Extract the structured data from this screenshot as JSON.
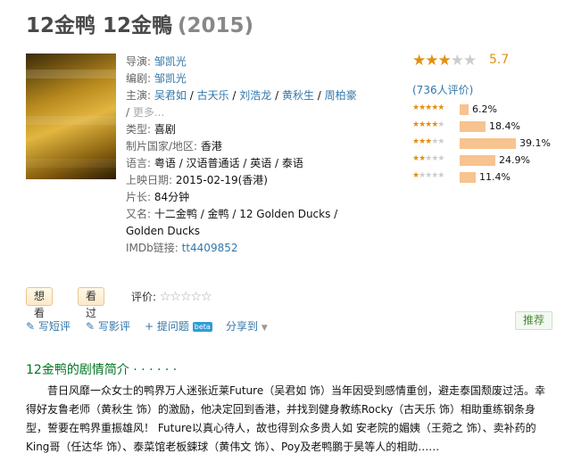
{
  "title": {
    "name": "12金鸭 12金鴨",
    "year": "(2015)"
  },
  "info": {
    "director_label": "导演:",
    "director": "邹凯光",
    "writer_label": "编剧:",
    "writer": "邹凯光",
    "cast_label": "主演:",
    "cast": [
      "吴君如",
      "古天乐",
      "刘浩龙",
      "黄秋生",
      "周柏豪"
    ],
    "sep": " / ",
    "more": "更多...",
    "genre_label": "类型:",
    "genre": "喜剧",
    "country_label": "制片国家/地区:",
    "country": "香港",
    "language_label": "语言:",
    "language": "粤语 / 汉语普通话 / 英语 / 泰语",
    "release_label": "上映日期:",
    "release": "2015-02-19(香港)",
    "runtime_label": "片长:",
    "runtime": "84分钟",
    "aka_label": "又名:",
    "aka": "十二金鸭 / 金鸭 / 12 Golden Ducks / Golden Ducks",
    "imdb_label": "IMDb链接:",
    "imdb": "tt4409852"
  },
  "rating": {
    "score": "5.7",
    "votes": "(736人评价)",
    "distribution": [
      {
        "stars": 5,
        "percent": 6.2,
        "label": "6.2%"
      },
      {
        "stars": 4,
        "percent": 18.4,
        "label": "18.4%"
      },
      {
        "stars": 3,
        "percent": 39.1,
        "label": "39.1%"
      },
      {
        "stars": 2,
        "percent": 24.9,
        "label": "24.9%"
      },
      {
        "stars": 1,
        "percent": 11.4,
        "label": "11.4%"
      }
    ],
    "star_color": "#e09015",
    "bar_color": "#f7c38f"
  },
  "actions": {
    "want": "想看",
    "seen": "看过",
    "my_rating": "评价:"
  },
  "links": {
    "short_review": "写短评",
    "review": "写影评",
    "ask": "提问题",
    "beta": "beta",
    "share": "分享到"
  },
  "recommend": "推荐",
  "summary": {
    "title": "12金鸭的剧情简介 · · · · · ·",
    "text": "昔日风靡一众女士的鸭界万人迷张近莱Future（吴君如 饰）当年因受到感情重创，避走泰国颓废过活。幸得好友鲁老师（黄秋生 饰）的激励，他决定回到香港，并找到健身教练Rocky（古天乐 饰）相助重练钢条身型，誓要在鸭界重振雄风！ Future以真心待人，故也得到众多贵人如 安老院的媚姨（王菀之 饰）、卖补药的King哥（任达华 饰）、泰菜馆老板鋉球（黄伟文 饰）、Poy及老鸭鹏于昊等人的相助……"
  }
}
